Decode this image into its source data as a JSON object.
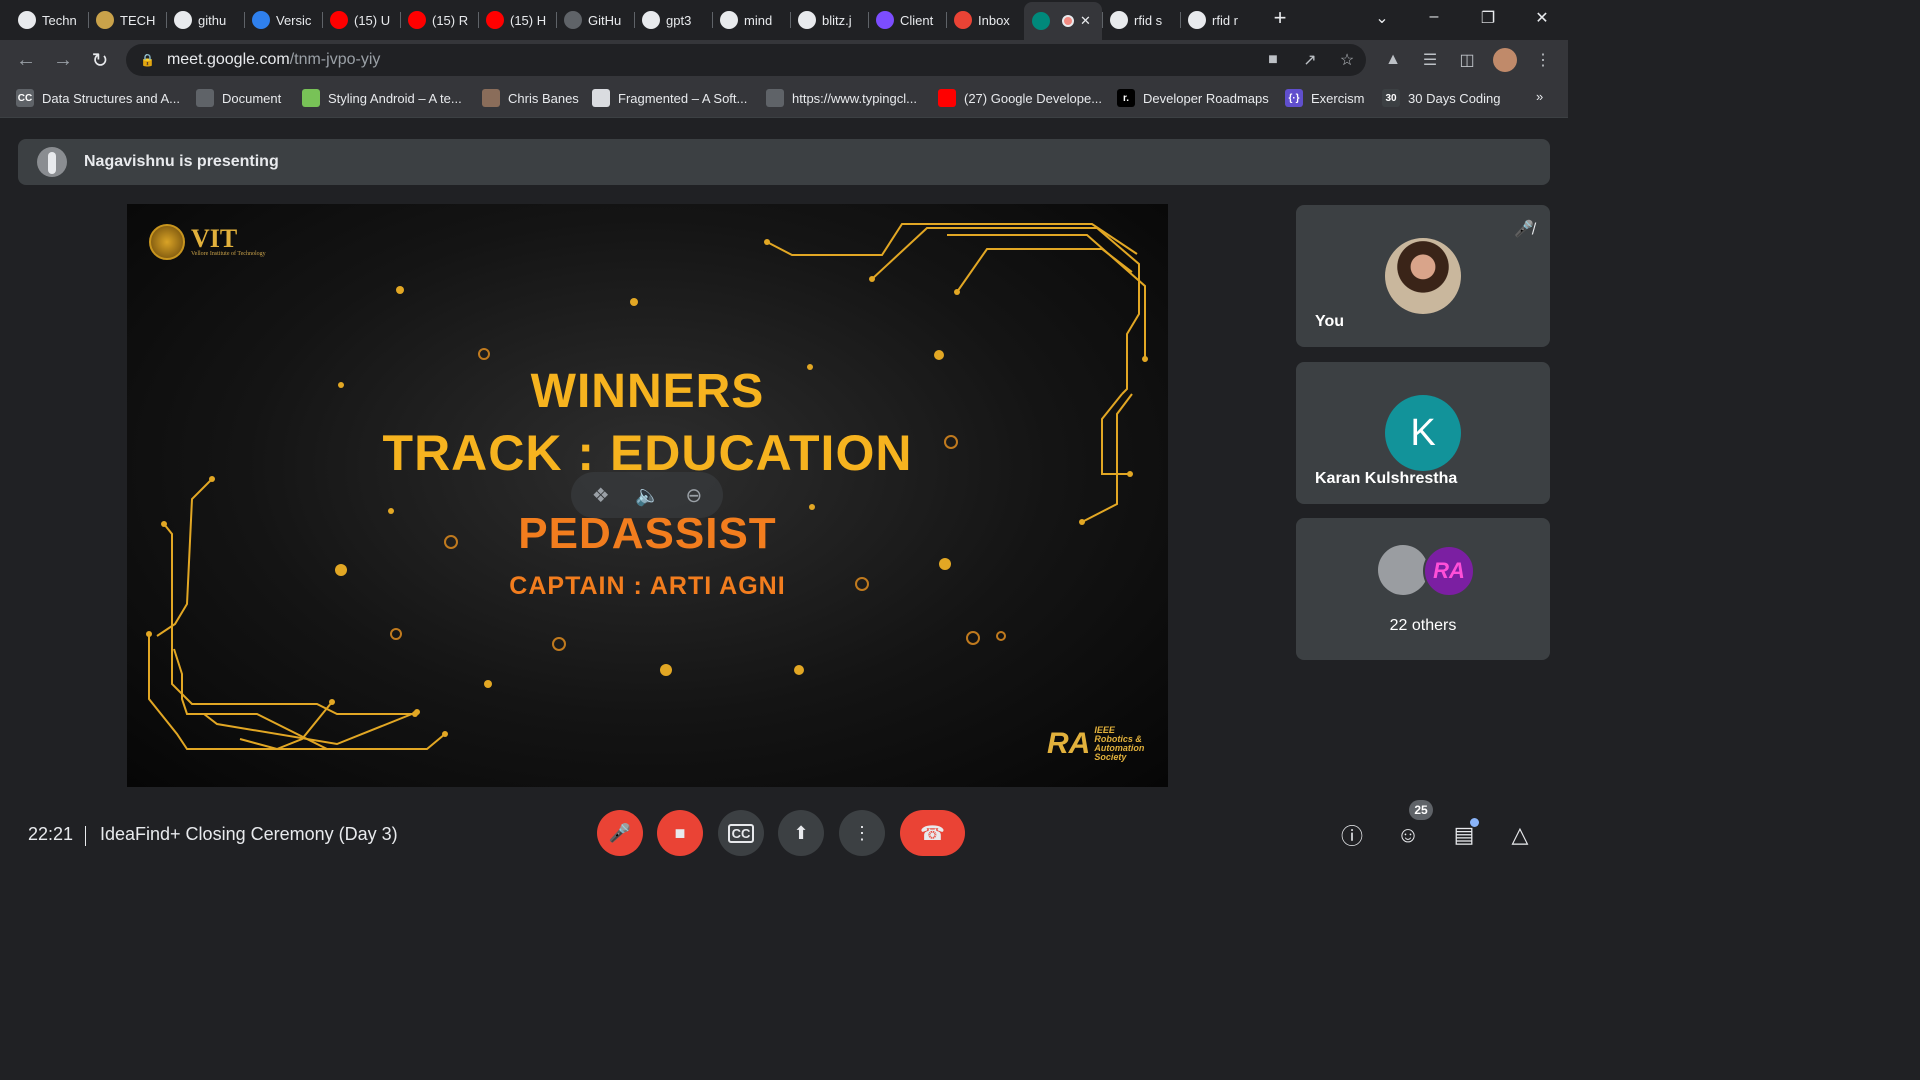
{
  "browser": {
    "tabs": [
      {
        "label": "Techn",
        "icon": "chrome-icon",
        "color": "#e8eaed"
      },
      {
        "label": "TECH",
        "icon": "site-icon",
        "color": "#c9a24a"
      },
      {
        "label": "githu",
        "icon": "google-icon",
        "color": "#e8eaed"
      },
      {
        "label": "Versic",
        "icon": "vscode-icon",
        "color": "#2f80ed"
      },
      {
        "label": "(15) U",
        "icon": "youtube-icon",
        "color": "#ff0000"
      },
      {
        "label": "(15) R",
        "icon": "youtube-icon",
        "color": "#ff0000"
      },
      {
        "label": "(15) H",
        "icon": "youtube-icon",
        "color": "#ff0000"
      },
      {
        "label": "GitHu",
        "icon": "github-icon",
        "color": "#5f6368"
      },
      {
        "label": "gpt3",
        "icon": "google-icon",
        "color": "#e8eaed"
      },
      {
        "label": "mind",
        "icon": "google-icon",
        "color": "#e8eaed"
      },
      {
        "label": "blitz.j",
        "icon": "google-icon",
        "color": "#e8eaed"
      },
      {
        "label": "Client",
        "icon": "bolt-icon",
        "color": "#7c4dff"
      },
      {
        "label": "Inbox",
        "icon": "gmail-icon",
        "color": "#ea4335"
      },
      {
        "label": "",
        "icon": "meet-icon",
        "color": "#00897b"
      },
      {
        "label": "rfid s",
        "icon": "google-icon",
        "color": "#e8eaed"
      },
      {
        "label": "rfid r",
        "icon": "google-icon",
        "color": "#e8eaed"
      }
    ],
    "new_tab": "+",
    "url_host": "meet.google.com",
    "url_path": "/tnm-jvpo-yiy",
    "bookmarks": [
      {
        "label": "Data Structures and A...",
        "icon": "cc-icon",
        "color": "#5f6368",
        "glyph": "CC"
      },
      {
        "label": "Document",
        "icon": "globe-icon",
        "color": "#5f6368",
        "glyph": ""
      },
      {
        "label": "Styling Android – A te...",
        "icon": "android-icon",
        "color": "#78c257",
        "glyph": ""
      },
      {
        "label": "Chris Banes",
        "icon": "avatar-icon",
        "color": "#8a6d5a",
        "glyph": ""
      },
      {
        "label": "Fragmented – A Soft...",
        "icon": "fragmented-icon",
        "color": "#dadce0",
        "glyph": ""
      },
      {
        "label": "https://www.typingcl...",
        "icon": "globe-icon",
        "color": "#5f6368",
        "glyph": ""
      },
      {
        "label": "(27) Google Develope...",
        "icon": "youtube-icon",
        "color": "#ff0000",
        "glyph": ""
      },
      {
        "label": "Developer Roadmaps",
        "icon": "roadmap-icon",
        "color": "#000000",
        "glyph": "r."
      },
      {
        "label": "Exercism",
        "icon": "exercism-icon",
        "color": "#604fcd",
        "glyph": "{·}"
      },
      {
        "label": "30 Days Coding",
        "icon": "coding-icon",
        "color": "#3c4043",
        "glyph": "30"
      }
    ],
    "more_bookmarks": "»"
  },
  "meet": {
    "presenting_text": "Nagavishnu is presenting",
    "slide": {
      "logo_text": "VIT",
      "logo_subtext": "Vellore Institute of Technology",
      "line1": "WINNERS",
      "line2": "TRACK : EDUCATION",
      "line3": "PEDASSIST",
      "line4": "CAPTAIN : ARTI AGNI",
      "footer_logo_text": "IEEE Robotics & Automation Society",
      "accent_color": "#f6b31f",
      "secondary_color": "#f27d1e"
    },
    "participants": [
      {
        "name": "You",
        "muted": true
      },
      {
        "name": "Karan Kulshrestha",
        "initial": "K",
        "avatar_color": "#12939a"
      },
      {
        "name": "22 others"
      }
    ],
    "bottom": {
      "time": "22:21",
      "meeting_title": "IdeaFind+ Closing Ceremony (Day 3)",
      "people_count": "25"
    },
    "colors": {
      "danger": "#ea4335",
      "surface": "#3c4043",
      "background": "#202124"
    }
  }
}
